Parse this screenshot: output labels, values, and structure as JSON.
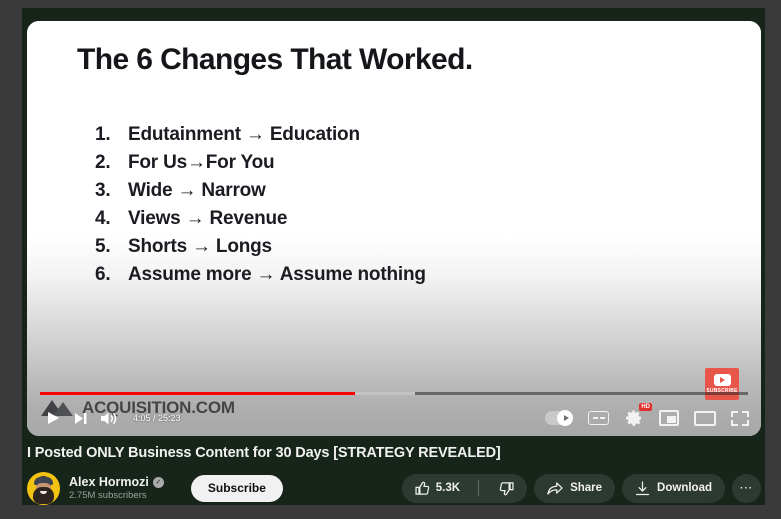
{
  "slide": {
    "title": "The 6 Changes That Worked.",
    "items": [
      {
        "num": "1.",
        "text": "Edutainment → Education"
      },
      {
        "num": "2.",
        "text": "For Us→For You"
      },
      {
        "num": "3.",
        "text": "Wide → Narrow"
      },
      {
        "num": "4.",
        "text": "Views → Revenue"
      },
      {
        "num": "5.",
        "text": "Shorts → Longs"
      },
      {
        "num": "6.",
        "text": "Assume more → Assume nothing"
      }
    ],
    "watermark_text": "ACQUISITION.COM",
    "watermark_icon": "acquisition-mountain-logo",
    "subscribe_watermark_label": "SUBSCRIBE",
    "subscribe_watermark_icon": "youtube-play-icon"
  },
  "player": {
    "current_time": "4:05",
    "total_time": "25:23",
    "time_display": "4:05 / 25:23",
    "progress_played_percent": 44.5,
    "progress_buffered_percent": 53,
    "progress_color": "#ff0000",
    "controls": {
      "play": "play-icon",
      "next": "next-track-icon",
      "volume": "volume-icon",
      "autoplay_toggle": "autoplay-toggle",
      "captions": "cc-icon",
      "settings": "gear-icon",
      "quality_badge": "HD",
      "miniplayer": "miniplayer-icon",
      "theater": "theater-mode-icon",
      "fullscreen": "fullscreen-icon"
    }
  },
  "video": {
    "title": "I Posted ONLY Business Content for 30 Days [STRATEGY REVEALED]"
  },
  "channel": {
    "name": "Alex Hormozi",
    "verified_icon": "verified-check-icon",
    "verified_glyph": "✓",
    "subscribers": "2.75M subscribers",
    "subscribe_label": "Subscribe",
    "avatar": "channel-avatar"
  },
  "actions": {
    "like_count": "5.3K",
    "like_icon": "thumbs-up-icon",
    "dislike_icon": "thumbs-down-icon",
    "share_label": "Share",
    "share_icon": "share-arrow-icon",
    "download_label": "Download",
    "download_icon": "download-icon",
    "more_label": "⋯",
    "more_icon": "more-horizontal-icon"
  },
  "theme": {
    "page_background": "#16241a",
    "outer_background": "#3a3a3a",
    "accent_red": "#ff0000",
    "text_primary": "#f1f1f1",
    "text_secondary": "#9aa39c"
  }
}
